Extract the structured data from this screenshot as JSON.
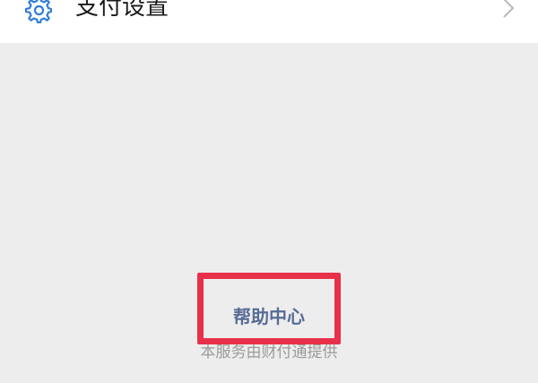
{
  "settings_row": {
    "label": "支付设置",
    "icon": "gear-icon",
    "chevron": "chevron-right-icon"
  },
  "footer": {
    "help_label": "帮助中心",
    "provider_note": "本服务由财付通提供"
  },
  "colors": {
    "accent_icon": "#2f7ed8",
    "link": "#576b95",
    "highlight": "#e8304a",
    "background": "#ededed"
  }
}
